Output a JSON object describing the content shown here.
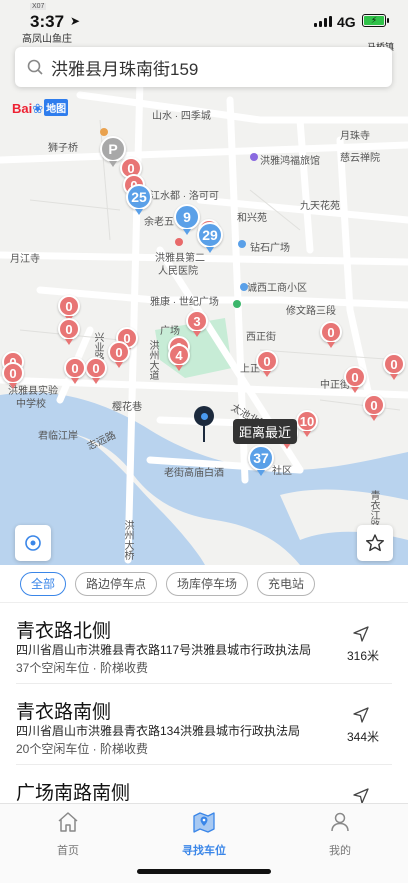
{
  "status_bar": {
    "time": "3:37",
    "network": "4G",
    "road_chip": "X07",
    "top_place": "高凤山鱼庄",
    "right_place": "马桥镇"
  },
  "search": {
    "query": "洪雅县月珠南街159"
  },
  "map": {
    "logo_text": "Bai",
    "logo_map": "地图",
    "labels": {
      "shanshui": "山水 · 四季城",
      "yuezhusi": "月珠寺",
      "cihuisi": "慈云禅院",
      "shizi": "狮子桥",
      "hongyahongfu": "洪雅鸿福旅馆",
      "jiulong": "九天花苑",
      "jiangshui": "江水都 · 洛可可",
      "yulaoquan": "余老五",
      "hepingyuan": "和兴苑",
      "yuejiangsi": "月江寺",
      "hospital1": "洪雅县第二",
      "hospital2": "人民医院",
      "zuanshi": "钻石广场",
      "chengxi": "诚西工商小区",
      "yakang": "雅康 · 世纪广场",
      "xiuwen": "修文路三段",
      "guangchang": "广场",
      "xingye": "兴业路",
      "hongzhou": "洪州大道",
      "xixi": "西正街",
      "shangzheng": "上正",
      "zhongzheng": "中正街",
      "school1": "洪雅县实验",
      "school2": "中学校",
      "yinghuang": "樱花巷",
      "junxin": "君临江岸",
      "zhiyuan": "志远路",
      "laoshi": "老街高庙白酒",
      "shequ": "社区",
      "hongzhou2": "洪州大桥",
      "taichi": "太池北路",
      "qingyi": "青衣江路",
      "nearest_tag": "距离最近"
    },
    "pins": [
      {
        "type": "red",
        "n": "0"
      },
      {
        "type": "red",
        "n": "0"
      },
      {
        "type": "blue",
        "n": "25"
      },
      {
        "type": "blue",
        "n": "9"
      },
      {
        "type": "red",
        "n": "0"
      },
      {
        "type": "blue",
        "n": "29"
      },
      {
        "type": "red",
        "n": "0"
      },
      {
        "type": "red",
        "n": "0"
      },
      {
        "type": "red",
        "n": "0"
      },
      {
        "type": "red",
        "n": "0"
      },
      {
        "type": "red",
        "n": "3"
      },
      {
        "type": "red",
        "n": "0"
      },
      {
        "type": "red",
        "n": "4"
      },
      {
        "type": "red",
        "n": "0"
      },
      {
        "type": "red",
        "n": "0"
      },
      {
        "type": "red",
        "n": "0"
      },
      {
        "type": "red",
        "n": "0"
      },
      {
        "type": "red",
        "n": "0"
      },
      {
        "type": "red",
        "n": "0"
      },
      {
        "type": "red",
        "n": "0"
      },
      {
        "type": "red",
        "n": "0"
      },
      {
        "type": "red",
        "n": "0"
      },
      {
        "type": "red",
        "n": "10"
      },
      {
        "type": "red",
        "n": "0"
      },
      {
        "type": "blue",
        "n": "37"
      },
      {
        "type": "gray",
        "n": "P"
      }
    ]
  },
  "filters": [
    "全部",
    "路边停车点",
    "场库停车场",
    "充电站"
  ],
  "results": [
    {
      "name": "青衣路北侧",
      "address": "四川省眉山市洪雅县青衣路117号洪雅县城市行政执法局",
      "meta": "37个空闲车位 · 阶梯收费",
      "distance": "316米"
    },
    {
      "name": "青衣路南侧",
      "address": "四川省眉山市洪雅县青衣路134洪雅县城市行政执法局",
      "meta": "20个空闲车位 · 阶梯收费",
      "distance": "344米"
    },
    {
      "name": "广场南路南侧",
      "address": "",
      "meta": "",
      "distance": ""
    }
  ],
  "tabs": [
    {
      "label": "首页",
      "icon": "home-icon"
    },
    {
      "label": "寻找车位",
      "icon": "map-icon"
    },
    {
      "label": "我的",
      "icon": "user-icon"
    }
  ],
  "colors": {
    "accent": "#3a86e8",
    "pin_red": "#e87575",
    "pin_blue": "#5aa0e8",
    "water": "#b9d3ee",
    "park": "#c7ecd6"
  }
}
